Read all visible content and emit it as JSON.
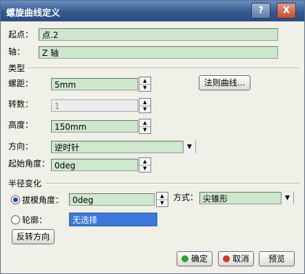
{
  "window": {
    "title": "螺旋曲线定义",
    "help_glyph": "?",
    "close_glyph": "X"
  },
  "fields": {
    "start_label": "起点：",
    "start_value": "点.2",
    "axis_label": "轴：",
    "axis_value": "Z 轴"
  },
  "type_section": {
    "title": "类型",
    "pitch_label": "螺距：",
    "pitch_value": "5mm",
    "law_button": "法则曲线...",
    "turns_label": "转数：",
    "turns_value": "1",
    "height_label": "高度：",
    "height_value": "150mm",
    "direction_label": "方向：",
    "direction_value": "逆时针",
    "start_angle_label": "起始角度：",
    "start_angle_value": "0deg"
  },
  "radius_section": {
    "title": "半径变化",
    "taper_label": "拔模角度：",
    "taper_value": "0deg",
    "mode_label": "方式：",
    "mode_value": "尖锥形",
    "profile_label": "轮廓：",
    "profile_value": "无选择",
    "reverse_button": "反转方向"
  },
  "footer": {
    "ok": "确定",
    "cancel": "取消",
    "preview": "预览"
  },
  "colors": {
    "field_bg": "#cfe6cf",
    "title_bar": "#35588d",
    "selection": "#3c78d8"
  }
}
